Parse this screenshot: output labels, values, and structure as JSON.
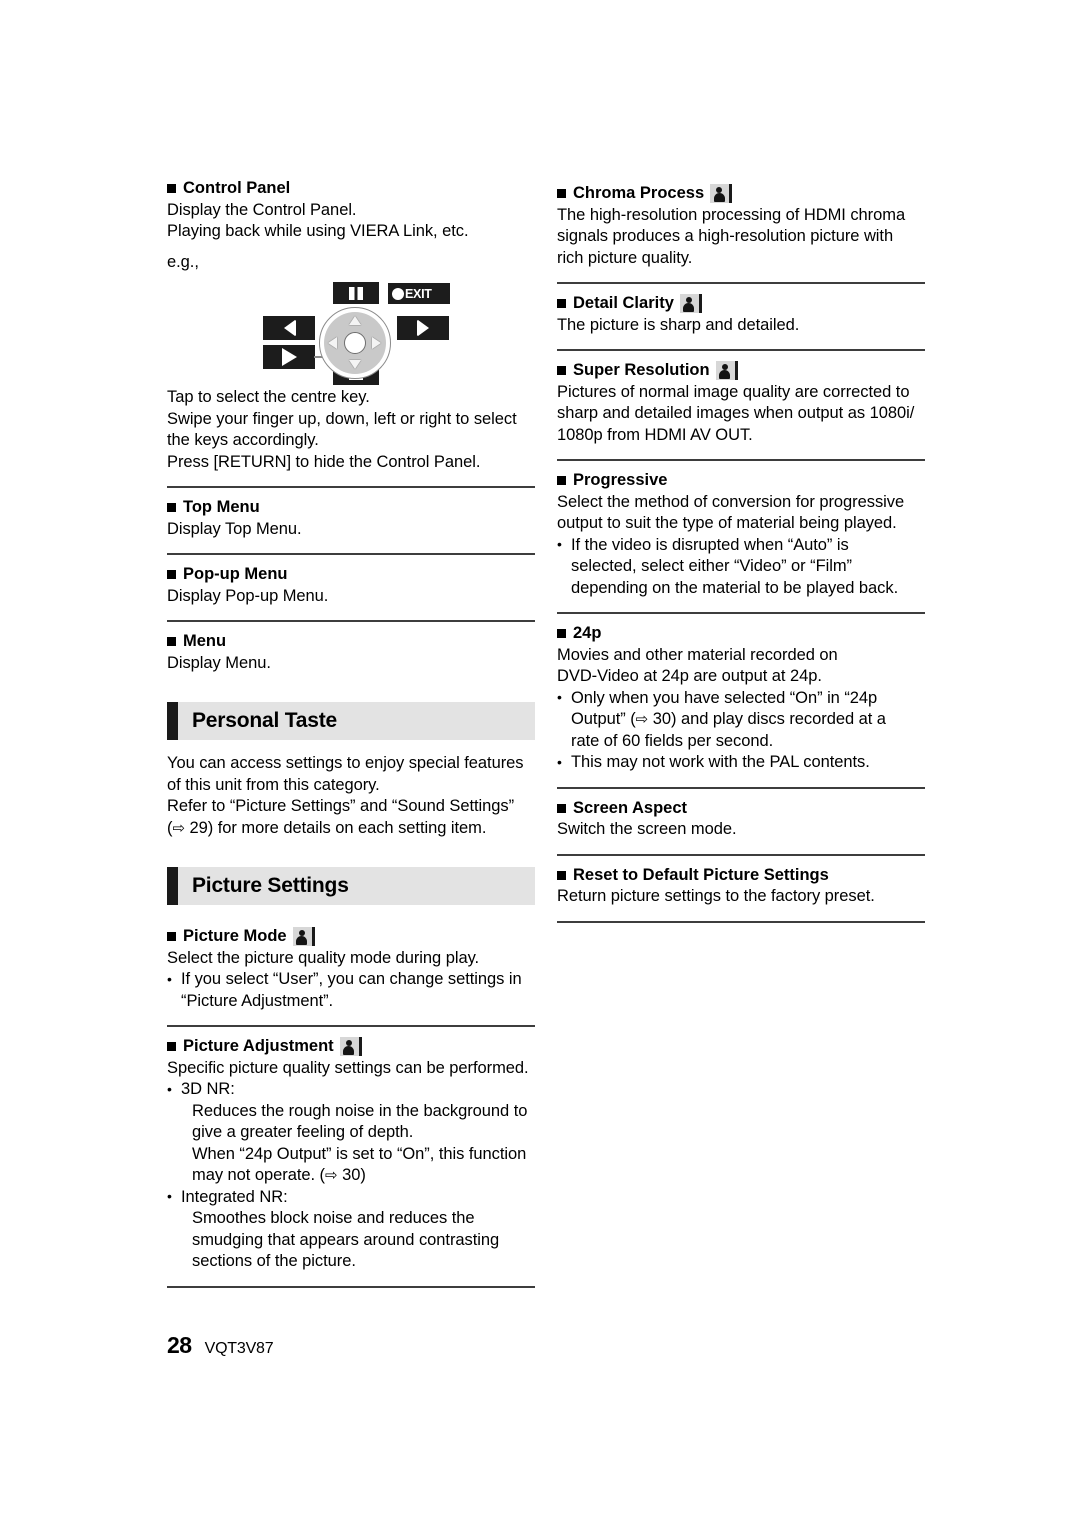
{
  "document": {
    "page_number": "28",
    "document_code": "VQT3V87"
  },
  "left_column": {
    "control_panel": {
      "heading": "Control Panel",
      "line1": "Display the Control Panel.",
      "line2": "Playing back while using VIERA Link, etc.",
      "eg_label": "e.g.,",
      "diagram": {
        "pause_key": "pause-key",
        "exit_key": "EXIT",
        "rewind_key": "rewind-key",
        "forward_key": "fast-forward-key",
        "play_key": "play-key",
        "stop_key": "stop-key",
        "dpad": "direction-pad"
      },
      "after1": "Tap to select the centre key.",
      "after2": "Swipe your finger up, down, left or right to select",
      "after3": "the keys accordingly.",
      "after4": "Press [RETURN] to hide the Control Panel."
    },
    "top_menu": {
      "heading": "Top Menu",
      "body": "Display Top Menu."
    },
    "popup_menu": {
      "heading": "Pop-up Menu",
      "body": "Display Pop-up Menu."
    },
    "menu": {
      "heading": "Menu",
      "body": "Display Menu."
    },
    "personal_taste": {
      "banner": "Personal Taste",
      "line1": "You can access settings to enjoy special features",
      "line2": "of this unit from this category.",
      "line3": "Refer to “Picture Settings” and “Sound Settings”",
      "line4_arrow": "⇨",
      "line4_a": "(",
      "line4_b": " 29) for more details on each setting item."
    },
    "picture_settings": {
      "banner": "Picture Settings"
    },
    "picture_mode": {
      "heading": "Picture Mode",
      "icon": "person-icon",
      "body": "Select the picture quality mode during play.",
      "bullet1_l1": "If you select “User”, you can change settings in",
      "bullet1_l2": "“Picture Adjustment”."
    },
    "picture_adjustment": {
      "heading": "Picture Adjustment",
      "icon": "person-icon",
      "body": "Specific picture quality settings can be performed.",
      "bullet1_label": "3D NR:",
      "bullet1_l1": "Reduces the rough noise in the background to",
      "bullet1_l2": "give a greater feeling of depth.",
      "bullet1_l3": "When “24p Output” is set to “On”, this function",
      "bullet1_l4_a": "may not operate. (",
      "bullet1_l4_arrow": "⇨",
      "bullet1_l4_b": " 30)",
      "bullet2_label": "Integrated NR:",
      "bullet2_l1": "Smoothes block noise and reduces the",
      "bullet2_l2": "smudging that appears around contrasting",
      "bullet2_l3": "sections of the picture."
    }
  },
  "right_column": {
    "chroma_process": {
      "heading": "Chroma Process",
      "icon": "person-icon",
      "l1": "The high-resolution processing of HDMI chroma",
      "l2": "signals produces a high-resolution picture with",
      "l3": "rich picture quality."
    },
    "detail_clarity": {
      "heading": "Detail Clarity",
      "icon": "person-icon",
      "l1": "The picture is sharp and detailed."
    },
    "super_resolution": {
      "heading": "Super Resolution",
      "icon": "person-icon",
      "l1": "Pictures of normal image quality are corrected to",
      "l2": "sharp and detailed images when output as 1080i/",
      "l3": "1080p from HDMI AV OUT."
    },
    "progressive": {
      "heading": "Progressive",
      "l1": "Select the method of conversion for progressive",
      "l2": "output to suit the type of material being played.",
      "b1_l1": "If the video is disrupted when “Auto” is",
      "b1_l2": "selected, select either “Video” or “Film”",
      "b1_l3": "depending on the material to be played back."
    },
    "p24": {
      "heading": "24p",
      "l1": "Movies and other material recorded on",
      "l2": "DVD-Video at 24p are output at 24p.",
      "b1_l1": "Only when you have selected “On” in “24p",
      "b1_l2_a": "Output” (",
      "b1_l2_arrow": "⇨",
      "b1_l2_b": " 30) and play discs recorded at a",
      "b1_l3": "rate of 60 fields per second.",
      "b2_l1": "This may not work with the PAL contents."
    },
    "screen_aspect": {
      "heading": "Screen Aspect",
      "l1": "Switch the screen mode."
    },
    "reset_defaults": {
      "heading": "Reset to Default Picture Settings",
      "l1": "Return picture settings to the factory preset."
    }
  }
}
